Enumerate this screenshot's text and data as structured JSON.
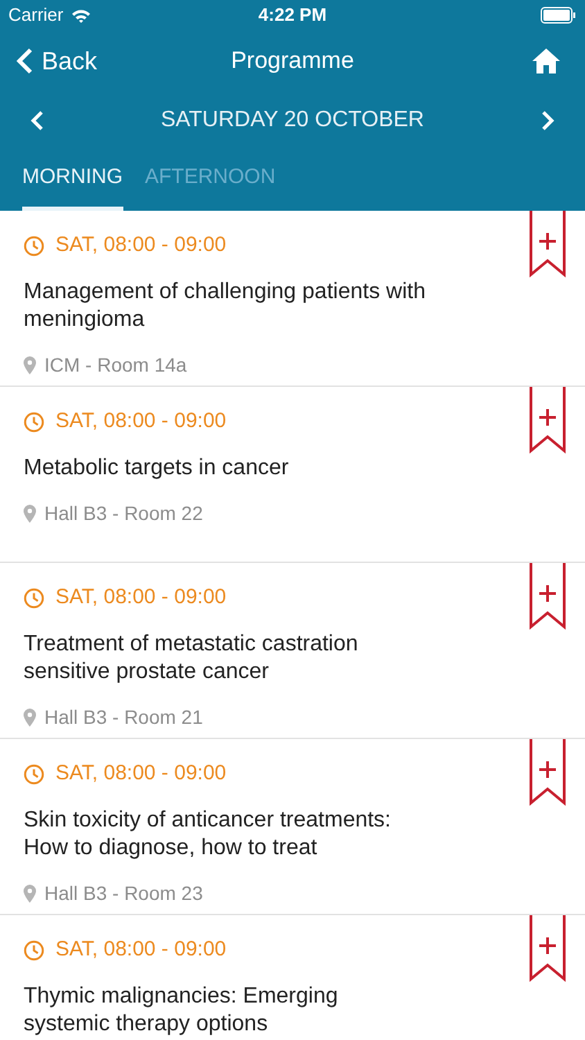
{
  "status_bar": {
    "carrier": "Carrier",
    "time": "4:22 PM"
  },
  "nav": {
    "back": "Back",
    "title": "Programme"
  },
  "date": "SATURDAY 20 OCTOBER",
  "tabs": [
    {
      "label": "MORNING",
      "selected": true
    },
    {
      "label": "AFTERNOON",
      "selected": false
    }
  ],
  "sessions": [
    {
      "time": "SAT, 08:00 - 09:00",
      "title": "Management of challenging patients with meningioma",
      "location": "ICM - Room 14a",
      "bookmarked": false
    },
    {
      "time": "SAT, 08:00 - 09:00",
      "title": "Metabolic targets in cancer",
      "location": "Hall B3 - Room 22",
      "bookmarked": false
    },
    {
      "time": "SAT, 08:00 - 09:00",
      "title": "Treatment of metastatic castration sensitive prostate cancer",
      "location": "Hall B3 - Room 21",
      "bookmarked": false
    },
    {
      "time": "SAT, 08:00 - 09:00",
      "title": "Skin toxicity of anticancer treatments: How to diagnose, how to treat",
      "location": "Hall B3 - Room 23",
      "bookmarked": false
    },
    {
      "time": "SAT, 08:00 - 09:00",
      "title": "Thymic malignancies: Emerging systemic therapy options",
      "bookmarked": false
    }
  ]
}
